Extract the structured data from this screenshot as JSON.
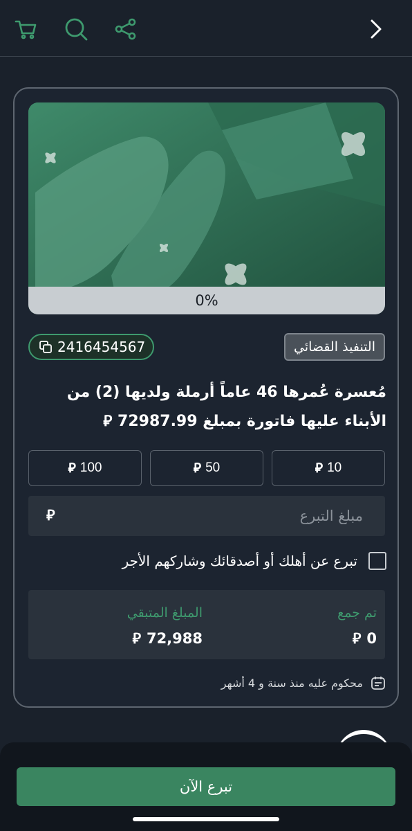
{
  "topbar": {
    "icons": [
      "cart-icon",
      "search-icon",
      "share-icon",
      "chevron-right-icon"
    ]
  },
  "hero": {
    "progress_label": "0%",
    "progress_value": 0
  },
  "case": {
    "id": "2416454567",
    "category": "التنفيذ القضائي",
    "title": "مُعسرة عُمرها 46 عاماً أرملة ولديها (2) من الأبناء عليها فاتورة بمبلغ 72987.99 ⃁"
  },
  "currency_symbol": "⃁",
  "amounts": [
    {
      "value": "100"
    },
    {
      "value": "50"
    },
    {
      "value": "10"
    }
  ],
  "donation_input": {
    "placeholder": "مبلغ التبرع",
    "value": ""
  },
  "gift_option": {
    "label": "تبرع عن أهلك أو أصدقائك وشاركهم الأجر",
    "checked": false
  },
  "stats": {
    "collected_label": "تم جمع",
    "collected_value": "0",
    "remaining_label": "المبلغ المتبقي",
    "remaining_value": "72,988"
  },
  "footnote": "محكوم عليه منذ سنة و 4 أشهر",
  "cta": {
    "label": "تبرع الآن"
  },
  "colors": {
    "accent": "#3e9a6e",
    "background": "#1a212b",
    "button": "#3a8560"
  }
}
